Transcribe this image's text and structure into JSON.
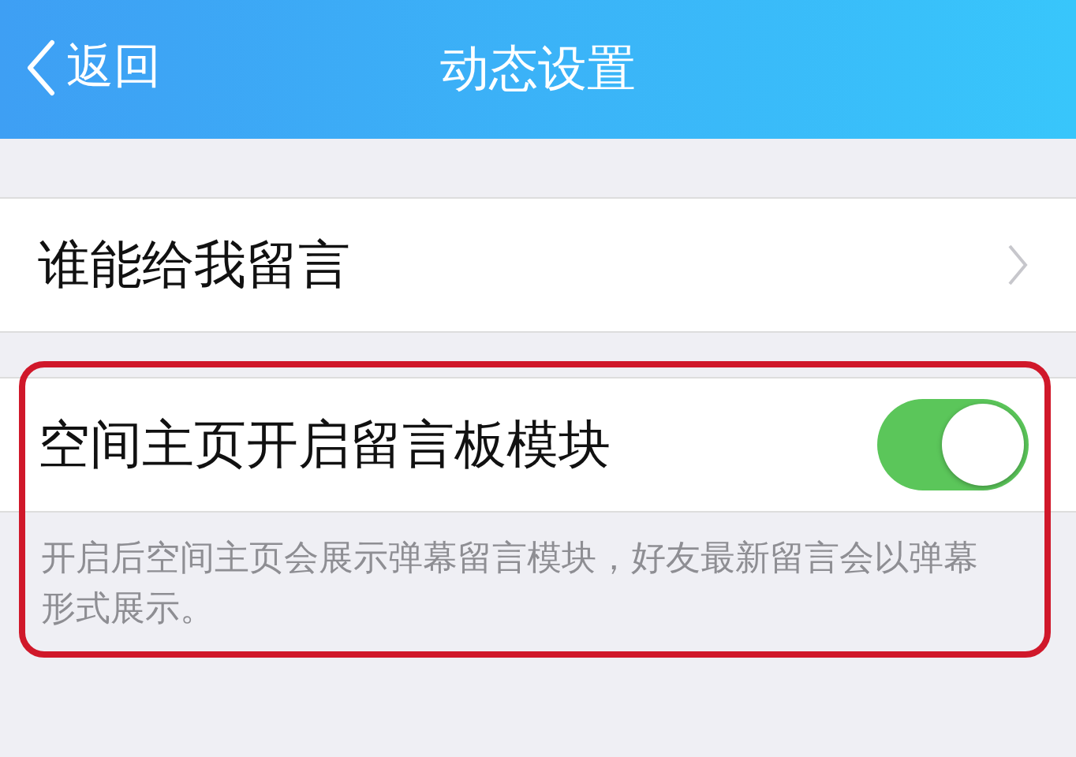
{
  "nav_bar": {
    "back": "返回",
    "title": "动态设置"
  },
  "sections": [
    {
      "kind": "link",
      "label": "谁能给我留言",
      "highlighted": false
    },
    {
      "kind": "switch",
      "label": "空间主页开启留言板模块",
      "on": true,
      "note": "开启后空间主页会展示弹幕留言模块，好友最新留言会以弹幕形式展示。",
      "highlighted": true
    }
  ]
}
